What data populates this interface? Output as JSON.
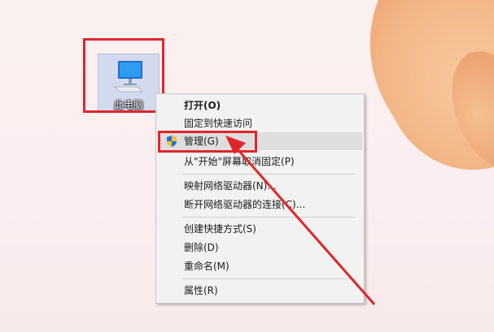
{
  "desktop": {
    "icon_label": "此电脑"
  },
  "context_menu": {
    "items": [
      {
        "label": "打开(O)",
        "bold": true
      },
      {
        "label": "固定到快速访问"
      },
      {
        "label": "管理(G)",
        "icon": "uac-shield-icon",
        "highlighted": true
      },
      {
        "label": "从\"开始\"屏幕取消固定(P)"
      },
      {
        "label": "映射网络驱动器(N)..."
      },
      {
        "label": "断开网络驱动器的连接(C)..."
      },
      {
        "label": "创建快捷方式(S)"
      },
      {
        "label": "删除(D)"
      },
      {
        "label": "重命名(M)"
      },
      {
        "label": "属性(R)"
      }
    ]
  },
  "colors": {
    "annotation_red": "#e0262b",
    "menu_bg": "#f2f2f2",
    "hover_bg": "#dedede"
  }
}
